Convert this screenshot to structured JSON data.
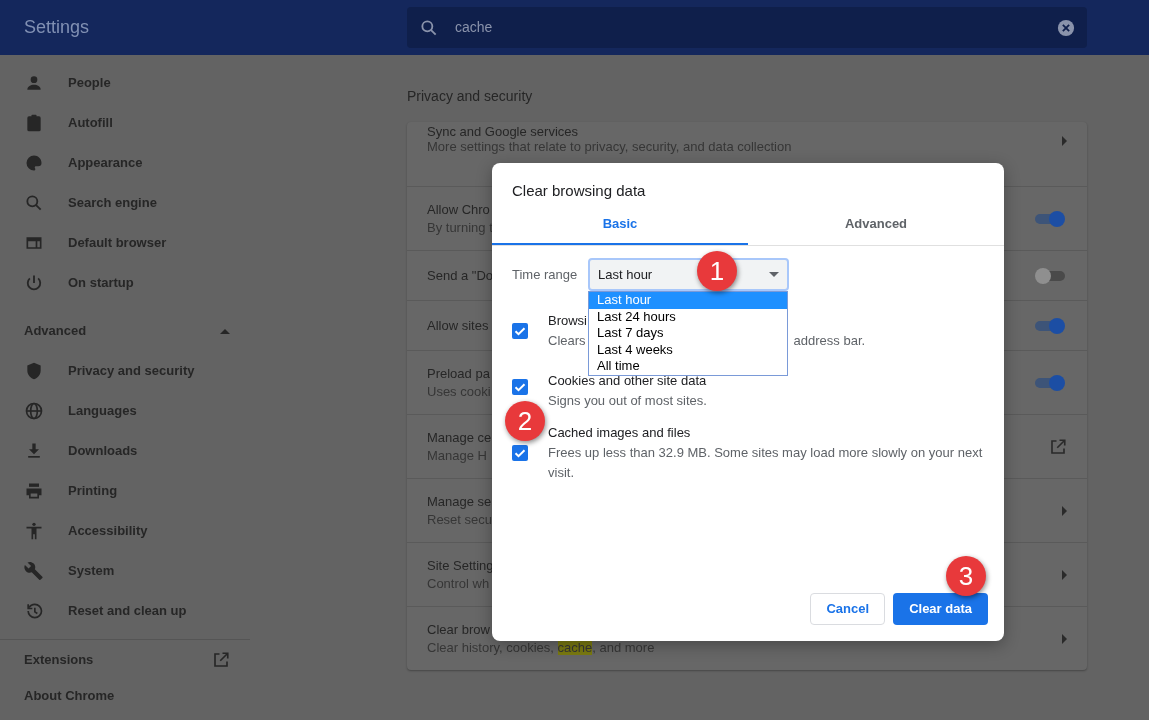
{
  "header": {
    "title": "Settings",
    "search": {
      "value": "cache"
    }
  },
  "sidebar": {
    "items": [
      {
        "label": "People"
      },
      {
        "label": "Autofill"
      },
      {
        "label": "Appearance"
      },
      {
        "label": "Search engine"
      },
      {
        "label": "Default browser"
      },
      {
        "label": "On startup"
      }
    ],
    "advanced": {
      "label": "Advanced",
      "expanded": true,
      "items": [
        {
          "label": "Privacy and security"
        },
        {
          "label": "Languages"
        },
        {
          "label": "Downloads"
        },
        {
          "label": "Printing"
        },
        {
          "label": "Accessibility"
        },
        {
          "label": "System"
        },
        {
          "label": "Reset and clean up"
        }
      ]
    },
    "footer": [
      {
        "label": "Extensions",
        "external": true
      },
      {
        "label": "About Chrome",
        "external": false
      }
    ]
  },
  "section_title": "Privacy and security",
  "settings": [
    {
      "title": "Sync and Google services",
      "subtitle": "More settings that relate to privacy, security, and data collection",
      "kind": "chevron"
    },
    {
      "title": "Allow Chro",
      "subtitle": "By turning t",
      "kind": "toggle",
      "on": true
    },
    {
      "title": "Send a \"Do",
      "kind": "toggle",
      "on": false
    },
    {
      "title": "Allow sites",
      "kind": "toggle",
      "on": true
    },
    {
      "title": "Preload pa",
      "subtitle": "Uses cooki",
      "kind": "toggle",
      "on": true
    },
    {
      "title": "Manage ce",
      "subtitle": "Manage H",
      "kind": "external"
    },
    {
      "title": "Manage se",
      "subtitle": "Reset secu",
      "kind": "chevron"
    },
    {
      "title": "Site Setting",
      "subtitle": "Control wh",
      "kind": "chevron"
    },
    {
      "title": "Clear brow",
      "subtitle_parts": [
        {
          "text": "Clear history, cookies, ",
          "highlight": false
        },
        {
          "text": "cache",
          "highlight": true
        },
        {
          "text": ", and more",
          "highlight": false
        }
      ],
      "kind": "chevron"
    }
  ],
  "dialog": {
    "title": "Clear browsing data",
    "tabs": [
      {
        "label": "Basic",
        "selected": true
      },
      {
        "label": "Advanced",
        "selected": false
      }
    ],
    "time_range": {
      "label": "Time range",
      "value": "Last hour",
      "expanded": true,
      "options": [
        {
          "label": "Last hour",
          "selected": true
        },
        {
          "label": "Last 24 hours",
          "selected": false
        },
        {
          "label": "Last 7 days",
          "selected": false
        },
        {
          "label": "Last 4 weeks",
          "selected": false
        },
        {
          "label": "All time",
          "selected": false
        }
      ]
    },
    "options": [
      {
        "title": "Browsi",
        "description_parts": [
          "Clears",
          "address bar."
        ],
        "checked": true
      },
      {
        "title": "Cookies and other site data",
        "description": "Signs you out of most sites.",
        "checked": true
      },
      {
        "title": "Cached images and files",
        "description": "Frees up less than 32.9 MB. Some sites may load more slowly on your next visit.",
        "checked": true
      }
    ],
    "buttons": [
      {
        "label": "Cancel",
        "kind": "secondary"
      },
      {
        "label": "Clear data",
        "kind": "primary"
      }
    ]
  },
  "callouts": [
    "1",
    "2",
    "3"
  ]
}
